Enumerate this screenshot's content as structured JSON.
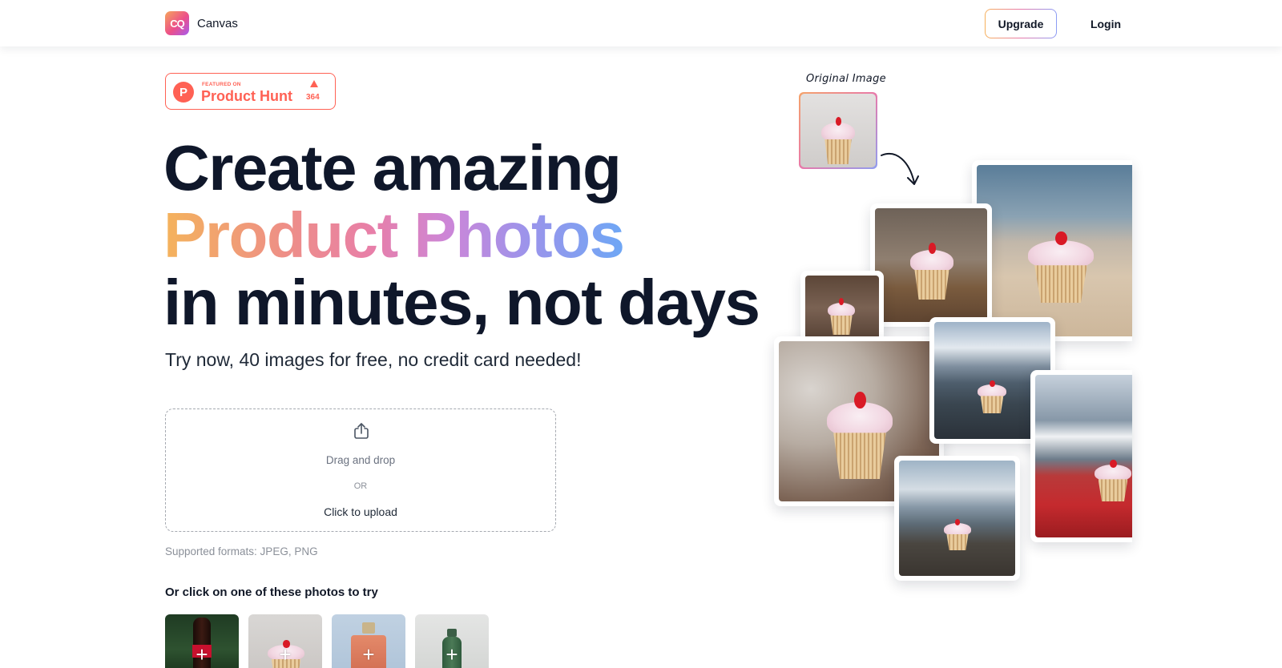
{
  "nav": {
    "logo_mark": "CQ",
    "brand": "Canvas",
    "upgrade_label": "Upgrade",
    "login_label": "Login"
  },
  "product_hunt": {
    "small_label": "FEATURED ON",
    "big_label": "Product Hunt",
    "upvotes": "364",
    "icon_letter": "P"
  },
  "hero": {
    "line1": "Create amazing",
    "line2": "Product Photos",
    "line3": "in minutes, not days",
    "subtitle": "Try now, 40 images for free, no credit card needed!"
  },
  "upload": {
    "icon": "upload-share-icon",
    "drag_text": "Drag and drop",
    "or_text": "OR",
    "click_text": "Click to upload",
    "formats": "Supported formats: JPEG, PNG"
  },
  "samples": {
    "title": "Or click on one of these photos to try",
    "items": [
      {
        "subject": "cola bottle",
        "plus": "+"
      },
      {
        "subject": "cupcake",
        "plus": "+"
      },
      {
        "subject": "perfume bottle",
        "plus": "+"
      },
      {
        "subject": "green bottle",
        "plus": "+"
      }
    ]
  },
  "collage": {
    "original_label": "Original Image"
  },
  "colors": {
    "brand_red": "#ff6154",
    "headline": "#0f172a",
    "gradient": [
      "#f4b35c",
      "#e87fa8",
      "#6ea7f5"
    ]
  }
}
